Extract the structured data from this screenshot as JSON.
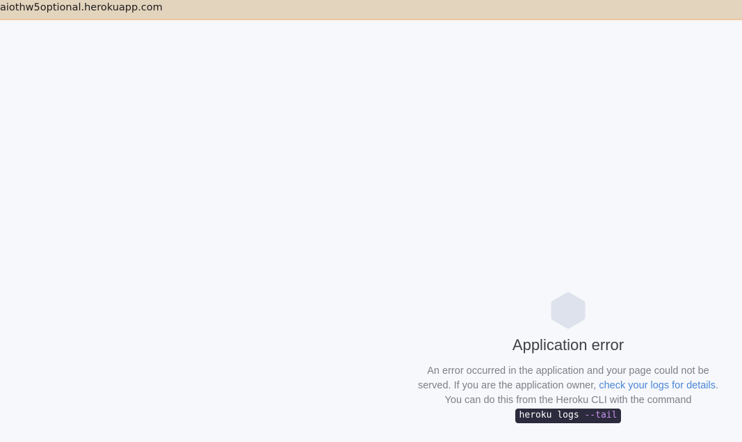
{
  "address_bar": {
    "url": "aiothw5optional.herokuapp.com"
  },
  "error": {
    "icon": "hexagon-icon",
    "title": "Application error",
    "line1": "An error occurred in the application and your page could not be",
    "line2_prefix": "served. If you are the application owner,",
    "logs_link": "check your logs for details",
    "line2_suffix": ".",
    "line3": "You can do this from the Heroku CLI with the command",
    "command_main": "heroku logs ",
    "command_flag": "--tail"
  },
  "colors": {
    "top_bar": "#e3d4bd",
    "page_background": "#f7f8fb",
    "hexagon": "#dde2ec",
    "link": "#4a86d6",
    "command_background": "#2c2a3d",
    "command_flag": "#c792ea"
  }
}
